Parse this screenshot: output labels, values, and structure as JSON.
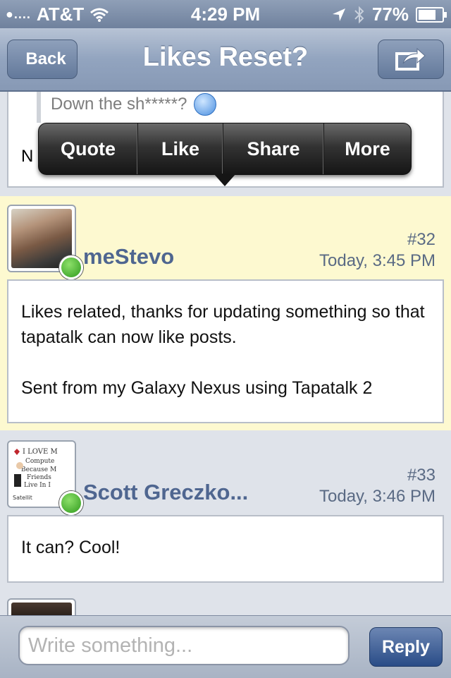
{
  "status_bar": {
    "carrier": "AT&T",
    "time": "4:29 PM",
    "battery": "77%",
    "battery_level": 0.77,
    "icons": [
      "signal-icon",
      "wifi-icon",
      "location-icon",
      "bluetooth-icon",
      "battery-icon"
    ]
  },
  "nav": {
    "back_label": "Back",
    "title": "Likes Reset?",
    "share_icon": "share-icon"
  },
  "previous_post": {
    "quote_text": "Down the sh*****?",
    "truncated_text": "N"
  },
  "popup_menu": {
    "items": [
      "Quote",
      "Like",
      "Share",
      "More"
    ]
  },
  "posts": [
    {
      "username": "meStevo",
      "number": "#32",
      "time": "Today, 3:45 PM",
      "body": [
        "Likes related, thanks for updating something so that tapatalk can now like posts.",
        "Sent from my Galaxy Nexus using Tapatalk 2"
      ],
      "online": true,
      "highlighted": true
    },
    {
      "username": "Scott Greczko...",
      "number": "#33",
      "time": "Today, 3:46 PM",
      "avatar_text": "I LOVE M Compute Because M Friends Live In I Satellit",
      "body": [
        "It can? Cool!"
      ],
      "online": true,
      "highlighted": false
    }
  ],
  "reply_bar": {
    "placeholder": "Write something...",
    "button_label": "Reply"
  },
  "colors": {
    "nav_blue": "#8799b5",
    "highlight_yellow": "#fdf9d0",
    "username_blue": "#4f6690",
    "reply_button": "#294c87",
    "online_green": "#2f9a1d"
  }
}
